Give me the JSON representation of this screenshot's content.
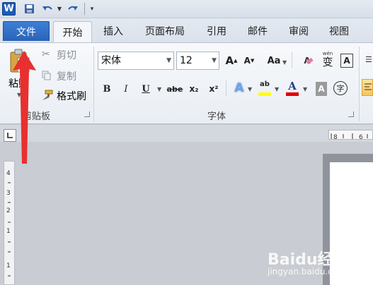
{
  "qat": {
    "logo": "W",
    "icons": [
      "save-icon",
      "undo-icon",
      "redo-icon",
      "customize-qat-icon"
    ]
  },
  "tabs": {
    "file": "文件",
    "home": "开始",
    "insert": "插入",
    "page_layout": "页面布局",
    "references": "引用",
    "mailings": "邮件",
    "review": "审阅",
    "view": "视图"
  },
  "clipboard": {
    "paste": "粘贴",
    "cut": "剪切",
    "copy": "复制",
    "format_painter": "格式刷",
    "label": "剪贴板"
  },
  "font": {
    "name": "宋体",
    "size": "12",
    "label": "字体",
    "grow": "A",
    "shrink": "A",
    "case": "Aa",
    "clear": "A",
    "phonetic": "wén",
    "phonetic_char": "变",
    "border_char": "A",
    "bold": "B",
    "italic": "I",
    "underline": "U",
    "strike": "abe",
    "subscript": "x₂",
    "superscript": "x²",
    "effects": "A",
    "highlight": "ab",
    "color": "A",
    "shade": "A",
    "enclose": "字"
  },
  "watermark": {
    "text": "Baidu经验",
    "url": "jingyan.baidu.com"
  },
  "colors": {
    "file_tab": "#2a63b8",
    "arrow": "#e8302f",
    "highlight": "#ffff00",
    "font_color": "#e00000"
  }
}
